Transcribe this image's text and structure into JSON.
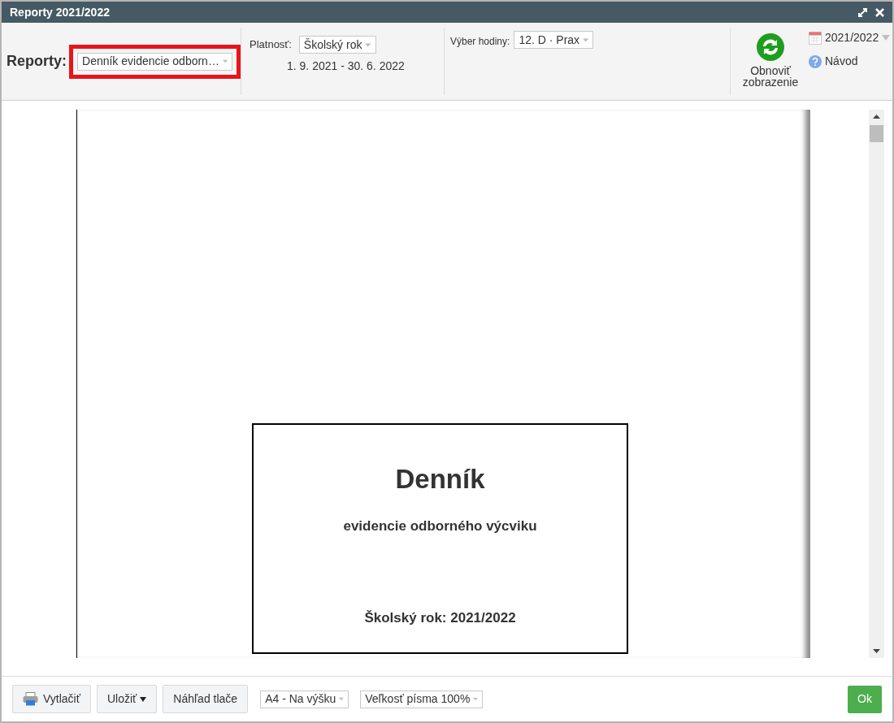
{
  "window": {
    "title": "Reporty 2021/2022"
  },
  "toolbar": {
    "reports": {
      "label": "Reporty:",
      "value": "Denník evidencie odborn…",
      "highlighted": true
    },
    "validity": {
      "label": "Platnosť:",
      "value": "Školský rok",
      "range": "1. 9. 2021 - 30. 6. 2022"
    },
    "hour": {
      "label": "Výber hodiny:",
      "value": "12. D · Prax"
    },
    "refresh": {
      "label": "Obnoviť zobrazenie"
    },
    "year": {
      "label": "2021/2022"
    },
    "help": {
      "label": "Návod"
    }
  },
  "document": {
    "title": "Denník",
    "subtitle": "evidencie odborného výcviku",
    "school_year": "Školský rok: 2021/2022"
  },
  "footer": {
    "print": "Vytlačiť",
    "save": "Uložiť",
    "preview": "Náhľad tlače",
    "paper": "A4 - Na výšku",
    "font_size": "Veľkosť písma 100%",
    "ok": "Ok"
  }
}
